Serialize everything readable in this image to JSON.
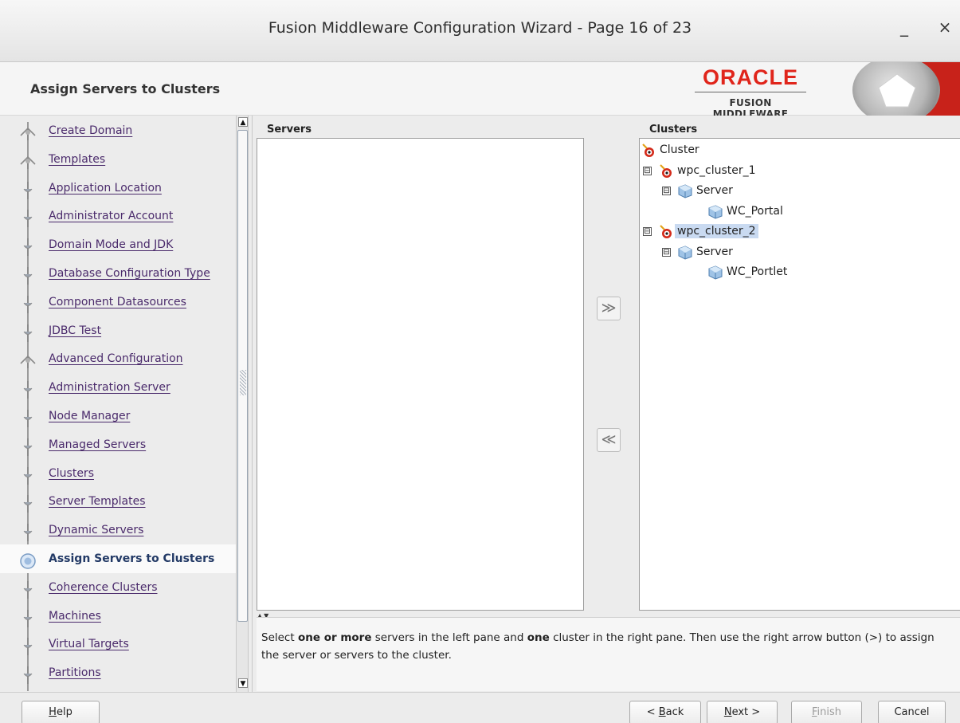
{
  "window": {
    "title": "Fusion Middleware Configuration Wizard - Page 16 of 23",
    "minimize_glyph": "_",
    "close_glyph": "×"
  },
  "header": {
    "page_heading": "Assign Servers to Clusters",
    "logo_brand": "ORACLE",
    "logo_product": "FUSION MIDDLEWARE"
  },
  "nav": {
    "items": [
      {
        "label": "Create Domain",
        "state": "done"
      },
      {
        "label": "Templates",
        "state": "done"
      },
      {
        "label": "Application Location",
        "state": "pending"
      },
      {
        "label": "Administrator Account",
        "state": "pending"
      },
      {
        "label": "Domain Mode and JDK",
        "state": "pending"
      },
      {
        "label": "Database Configuration Type",
        "state": "pending"
      },
      {
        "label": "Component Datasources",
        "state": "pending"
      },
      {
        "label": "JDBC Test",
        "state": "pending"
      },
      {
        "label": "Advanced Configuration",
        "state": "done"
      },
      {
        "label": "Administration Server",
        "state": "pending"
      },
      {
        "label": "Node Manager",
        "state": "pending"
      },
      {
        "label": "Managed Servers",
        "state": "pending"
      },
      {
        "label": "Clusters",
        "state": "pending"
      },
      {
        "label": "Server Templates",
        "state": "pending"
      },
      {
        "label": "Dynamic Servers",
        "state": "pending"
      },
      {
        "label": "Assign Servers to Clusters",
        "state": "current"
      },
      {
        "label": "Coherence Clusters",
        "state": "pending"
      },
      {
        "label": "Machines",
        "state": "pending"
      },
      {
        "label": "Virtual Targets",
        "state": "pending"
      },
      {
        "label": "Partitions",
        "state": "pending"
      }
    ],
    "scroll_up_glyph": "▲",
    "scroll_down_glyph": "▼"
  },
  "servers_pane": {
    "title": "Servers",
    "items": []
  },
  "clusters_pane": {
    "title": "Clusters",
    "tree": {
      "root": "Cluster",
      "clusters": [
        {
          "name": "wpc_cluster_1",
          "expander": "⊟",
          "group_label": "Server",
          "group_expander": "⊟",
          "servers": [
            "WC_Portal"
          ],
          "selected": false
        },
        {
          "name": "wpc_cluster_2",
          "expander": "⊟",
          "group_label": "Server",
          "group_expander": "⊟",
          "servers": [
            "WC_Portlet"
          ],
          "selected": true
        }
      ]
    }
  },
  "transfer": {
    "assign_glyph": "≫",
    "unassign_glyph": "≪"
  },
  "description": {
    "text_parts": [
      {
        "t": "Select ",
        "b": false
      },
      {
        "t": "one or more",
        "b": true
      },
      {
        "t": " servers in the left pane and ",
        "b": false
      },
      {
        "t": "one",
        "b": true
      },
      {
        "t": " cluster in the right pane. Then use the right arrow button (>) to assign the server or servers to the cluster.",
        "b": false
      }
    ]
  },
  "footer": {
    "help": {
      "mnemonic": "H",
      "rest": "elp"
    },
    "back": {
      "prefix": "< ",
      "mnemonic": "B",
      "rest": "ack"
    },
    "next": {
      "mnemonic": "N",
      "rest": "ext >"
    },
    "finish": {
      "mnemonic": "F",
      "rest": "inish"
    },
    "cancel": "Cancel"
  },
  "colors": {
    "oracle_red": "#e0251b",
    "nav_link": "#4a2a6b",
    "nav_current": "#233a66",
    "selection": "#c9daf1"
  }
}
